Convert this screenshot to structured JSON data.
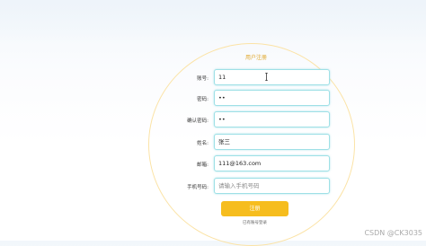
{
  "form": {
    "title": "用户注册",
    "fields": [
      {
        "label": "账号:",
        "value": "11"
      },
      {
        "label": "密码:",
        "value": "••"
      },
      {
        "label": "确认密码:",
        "value": "••"
      },
      {
        "label": "姓名:",
        "value": "张三"
      },
      {
        "label": "邮箱:",
        "value": "111@163.com"
      },
      {
        "label": "手机号码:",
        "placeholder": "请输入手机号码",
        "value": ""
      }
    ],
    "submit_label": "注册",
    "login_link": "已有账号登录"
  },
  "watermark": "CSDN @CK3035",
  "colors": {
    "accent": "#f6bd1e",
    "field_border": "#9ee0e6",
    "ring": "#fbe3a6"
  }
}
